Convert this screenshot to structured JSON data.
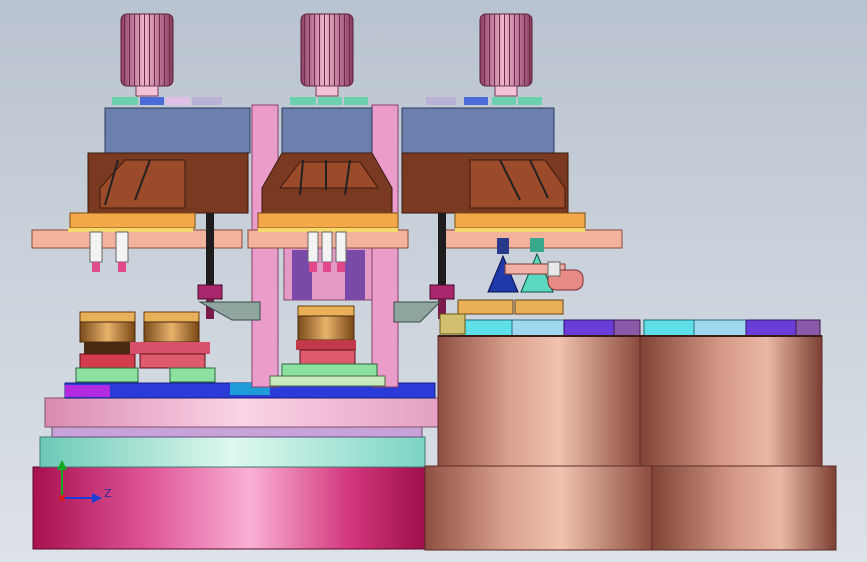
{
  "viewport": {
    "background_top": "#b9c3cf",
    "background_bottom": "#dde2e8"
  },
  "triad": {
    "z_label": "Z",
    "x_color": "#1b3fd6",
    "y_color": "#0fa81f",
    "origin_color": "#d81a1a"
  },
  "colors": {
    "brown": "#7a3a22",
    "brown_light": "#9a4a2a",
    "blue_gray": "#6b7fa8",
    "pink": "#e58bc2",
    "salmon": "#f2b29b",
    "orange": "#f3a64a",
    "copper": "#c98671",
    "copper_dark": "#8b4b3e",
    "magenta": "#c4246a",
    "teal": "#6fd3c4",
    "mint": "#9ee7c8"
  }
}
